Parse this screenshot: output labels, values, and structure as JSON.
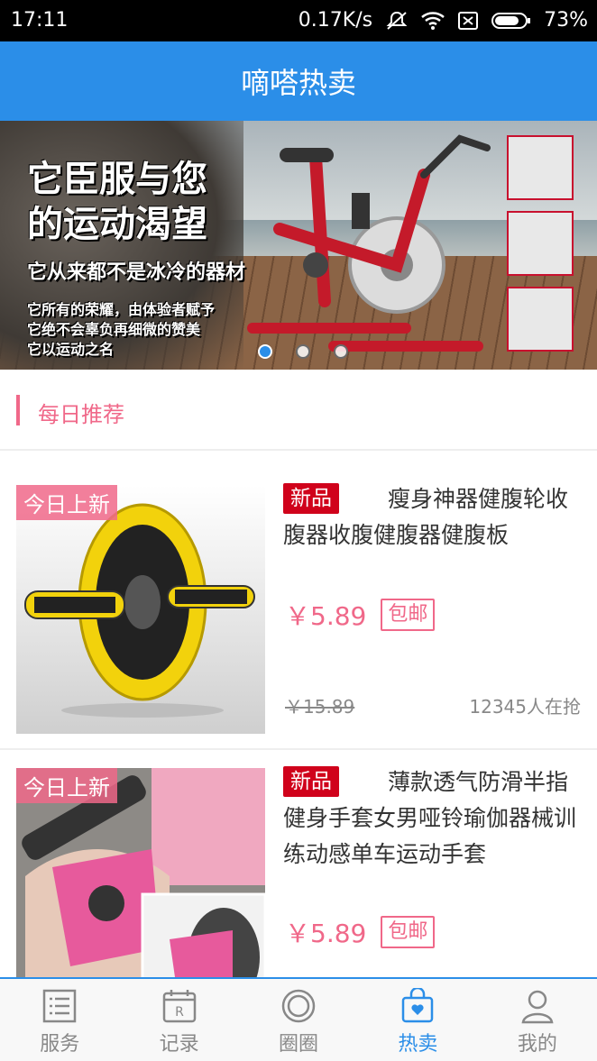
{
  "status_bar": {
    "time": "17:11",
    "network_speed": "0.17K/s",
    "battery": "73%"
  },
  "header": {
    "title": "嘀嗒热卖"
  },
  "banner": {
    "headline_1": "它臣服与您",
    "headline_2": "的运动渴望",
    "subline": "它从来都不是冰冷的器材",
    "small_1": "它所有的荣耀，由体验者赋予",
    "small_2": "它绝不会辜负再细微的赞美",
    "small_3": "它以运动之名",
    "slides": 3,
    "active_slide": 1
  },
  "section": {
    "title": "每日推荐"
  },
  "products": [
    {
      "ribbon": "今日上新",
      "new_tag": "新品",
      "title": "瘦身神器健腹轮收腹器收腹健腹器健腹板",
      "price": "￥5.89",
      "shipping": "包邮",
      "old_price": "￥15.89",
      "buyers": "12345人在抢"
    },
    {
      "ribbon": "今日上新",
      "new_tag": "新品",
      "title": "薄款透气防滑半指健身手套女男哑铃瑜伽器械训练动感单车运动手套",
      "price": "￥5.89",
      "shipping": "包邮"
    }
  ],
  "tabbar": {
    "items": [
      {
        "label": "服务",
        "icon": "list-icon"
      },
      {
        "label": "记录",
        "icon": "calendar-icon"
      },
      {
        "label": "圈圈",
        "icon": "circle-icon"
      },
      {
        "label": "热卖",
        "icon": "shopping-bag-icon",
        "active": true
      },
      {
        "label": "我的",
        "icon": "person-icon"
      }
    ]
  },
  "colors": {
    "accent": "#2b8ee8",
    "pink": "#f06889",
    "new_tag": "#d0021b"
  }
}
